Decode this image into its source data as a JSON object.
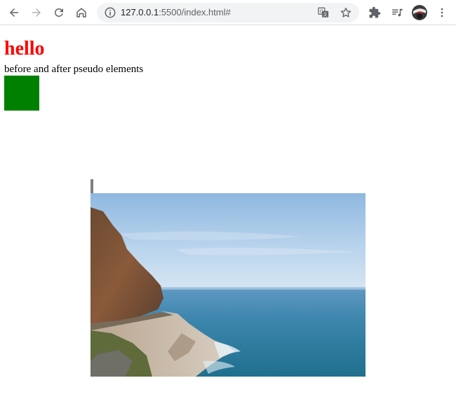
{
  "browser": {
    "url_host": "127.0.0.1",
    "url_rest": ":5500/index.html#",
    "icons": {
      "back": "arrow-left-icon",
      "forward": "arrow-right-icon",
      "reload": "reload-icon",
      "home": "home-icon",
      "site_info": "info-icon",
      "translate": "translate-icon",
      "bookmark": "star-icon",
      "extensions": "puzzle-icon",
      "media": "playlist-icon",
      "profile": "avatar",
      "menu": "kebab-menu-icon"
    }
  },
  "page": {
    "heading": "hello",
    "subtext": "before and after pseudo elements",
    "colors": {
      "heading": "#ff0000",
      "box": "#008000",
      "bar": "#808080"
    }
  }
}
